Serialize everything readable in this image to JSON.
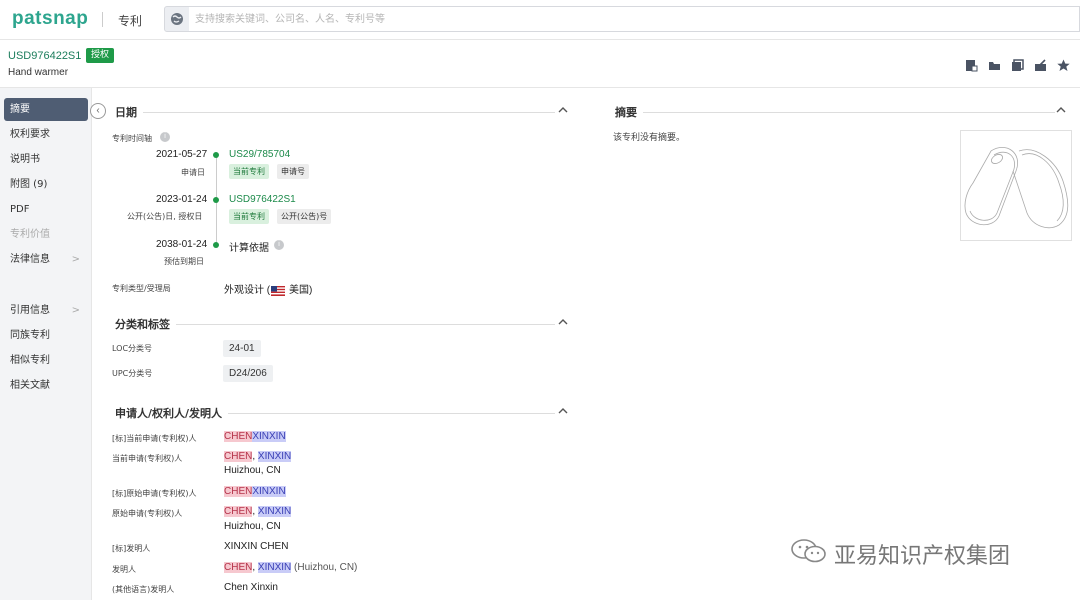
{
  "topbar": {
    "logo": "patsnap",
    "module": "专利",
    "search_placeholder": "支持搜索关键词、公司名、人名、专利号等"
  },
  "patent": {
    "number": "USD976422S1",
    "status_badge": "授权",
    "title": "Hand warmer"
  },
  "sidebar": {
    "items": [
      {
        "label": "摘要",
        "active": true
      },
      {
        "label": "权利要求"
      },
      {
        "label": "说明书"
      },
      {
        "label": "附图 (9)"
      },
      {
        "label": "PDF"
      },
      {
        "label": "专利价值",
        "disabled": true
      },
      {
        "label": "法律信息",
        "arrow": ">"
      },
      {
        "label": "引用信息",
        "arrow": ">"
      },
      {
        "label": "同族专利"
      },
      {
        "label": "相似专利"
      },
      {
        "label": "相关文献"
      }
    ]
  },
  "dates": {
    "section_title": "日期",
    "timeline_label": "专利时间轴",
    "events": [
      {
        "date": "2021-05-27",
        "date_label": "申请日",
        "number": "US29/785704",
        "tags": [
          "当前专利",
          "申请号"
        ]
      },
      {
        "date": "2023-01-24",
        "date_label": "公开(公告)日, 授权日",
        "number": "USD976422S1",
        "tags": [
          "当前专利",
          "公开(公告)号"
        ]
      },
      {
        "date": "2038-01-24",
        "date_label": "预估到期日",
        "number": "计算依据"
      }
    ],
    "type_label": "专利类型/受理局",
    "type_value": "外观设计 (",
    "country": "美国)"
  },
  "abstract": {
    "section_title": "摘要",
    "text": "该专利没有摘要。"
  },
  "classification": {
    "section_title": "分类和标签",
    "loc_label": "LOC分类号",
    "loc_value": "24-01",
    "upc_label": "UPC分类号",
    "upc_value": "D24/206"
  },
  "applicants": {
    "section_title": "申请人/权利人/发明人",
    "rows": [
      {
        "label": "[标]当前申请(专利权)人",
        "v1": "CHEN",
        "v2": "XINXIN"
      },
      {
        "label": "当前申请(专利权)人",
        "v1": "CHEN",
        "sep": ", ",
        "v2": "XINXIN",
        "location": "Huizhou, CN"
      },
      {
        "label": "[标]原始申请(专利权)人",
        "v1": "CHEN",
        "v2": "XINXIN"
      },
      {
        "label": "原始申请(专利权)人",
        "v1": "CHEN",
        "sep": ", ",
        "v2": "XINXIN",
        "location": "Huizhou, CN"
      },
      {
        "label": "[标]发明人",
        "plain": "XINXIN CHEN"
      },
      {
        "label": "发明人",
        "v1": "CHEN",
        "sep": ", ",
        "v2": "XINXIN",
        "suffix": " (Huizhou, CN)"
      },
      {
        "label": "(其他语言)发明人",
        "plain": "Chen Xinxin"
      }
    ]
  },
  "watermark": "亚易知识产权集团",
  "colors": {
    "brand": "#2da58e",
    "status_green": "#1e9a48",
    "highlight_red": "#f6c8cf",
    "highlight_blue": "#c9ccf7"
  }
}
